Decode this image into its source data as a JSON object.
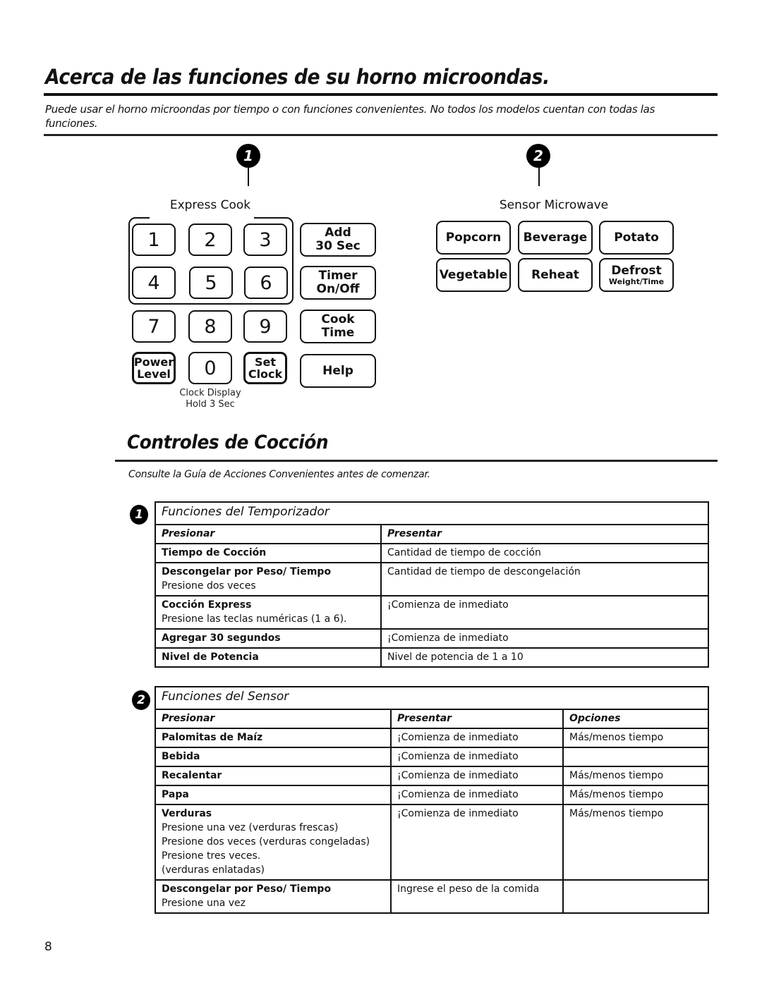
{
  "page": {
    "title": "Acerca de las funciones de su horno microondas.",
    "intro": "Puede usar el horno microondas por tiempo o con funciones convenientes. No todos los modelos cuentan con todas las funciones.",
    "page_number": "8"
  },
  "control_panel": {
    "callout_1": "1",
    "callout_2": "2",
    "express_cook_label": "Express Cook",
    "sensor_label": "Sensor Microwave",
    "number_keys": [
      "1",
      "2",
      "3",
      "4",
      "5",
      "6",
      "7",
      "8",
      "9",
      "0"
    ],
    "power_level": {
      "line1": "Power",
      "line2": "Level"
    },
    "set_clock": {
      "line1": "Set",
      "line2": "Clock"
    },
    "add_30": {
      "line1": "Add",
      "line2": "30 Sec"
    },
    "timer": {
      "line1": "Timer",
      "line2": "On/Off"
    },
    "cook_time": {
      "line1": "Cook",
      "line2": "Time"
    },
    "help": "Help",
    "clock_note": {
      "line1": "Clock Display",
      "line2": "Hold 3 Sec"
    },
    "sensor_keys": {
      "popcorn": "Popcorn",
      "beverage": "Beverage",
      "potato": "Potato",
      "vegetable": "Vegetable",
      "reheat": "Reheat",
      "defrost": "Defrost",
      "defrost_sub": "Weight/Time"
    }
  },
  "cooking_controls": {
    "title": "Controles de Cocción",
    "note": "Consulte la Guía de Acciones Convenientes antes de comenzar."
  },
  "timer_table": {
    "badge": "1",
    "caption": "Funciones del Temporizador",
    "headers": [
      "Presionar",
      "Presentar"
    ],
    "rows": [
      {
        "press": "Tiempo de Cocción",
        "press_sub": "",
        "display": "Cantidad de tiempo de cocción"
      },
      {
        "press": "Descongelar por Peso/ Tiempo",
        "press_sub": "Presione dos veces",
        "display": "Cantidad de tiempo de descongelación"
      },
      {
        "press": "Cocción Express",
        "press_sub": "Presione las teclas numéricas (1 a 6).",
        "display": "¡Comienza de inmediato"
      },
      {
        "press": "Agregar 30 segundos",
        "press_sub": "",
        "display": "¡Comienza de inmediato"
      },
      {
        "press": "Nivel de Potencia",
        "press_sub": "",
        "display": "Nivel de potencia de 1 a 10"
      }
    ]
  },
  "sensor_table": {
    "badge": "2",
    "caption": "Funciones del Sensor",
    "headers": [
      "Presionar",
      "Presentar",
      "Opciones"
    ],
    "rows": [
      {
        "press": "Palomitas de Maíz",
        "press_sub": [],
        "display": "¡Comienza de inmediato",
        "options": "Más/menos tiempo"
      },
      {
        "press": "Bebida",
        "press_sub": [],
        "display": "¡Comienza de inmediato",
        "options": ""
      },
      {
        "press": "Recalentar",
        "press_sub": [],
        "display": "¡Comienza de inmediato",
        "options": "Más/menos tiempo"
      },
      {
        "press": "Papa",
        "press_sub": [],
        "display": "¡Comienza de inmediato",
        "options": "Más/menos tiempo"
      },
      {
        "press": "Verduras",
        "press_sub": [
          "Presione una vez (verduras frescas)",
          "Presione dos veces (verduras congeladas)",
          "Presione tres veces.",
          "(verduras enlatadas)"
        ],
        "display": "¡Comienza de inmediato",
        "options": "Más/menos tiempo"
      },
      {
        "press": "Descongelar por Peso/ Tiempo",
        "press_sub": [
          "Presione una vez"
        ],
        "display": "Ingrese el peso de la comida",
        "options": ""
      }
    ]
  }
}
